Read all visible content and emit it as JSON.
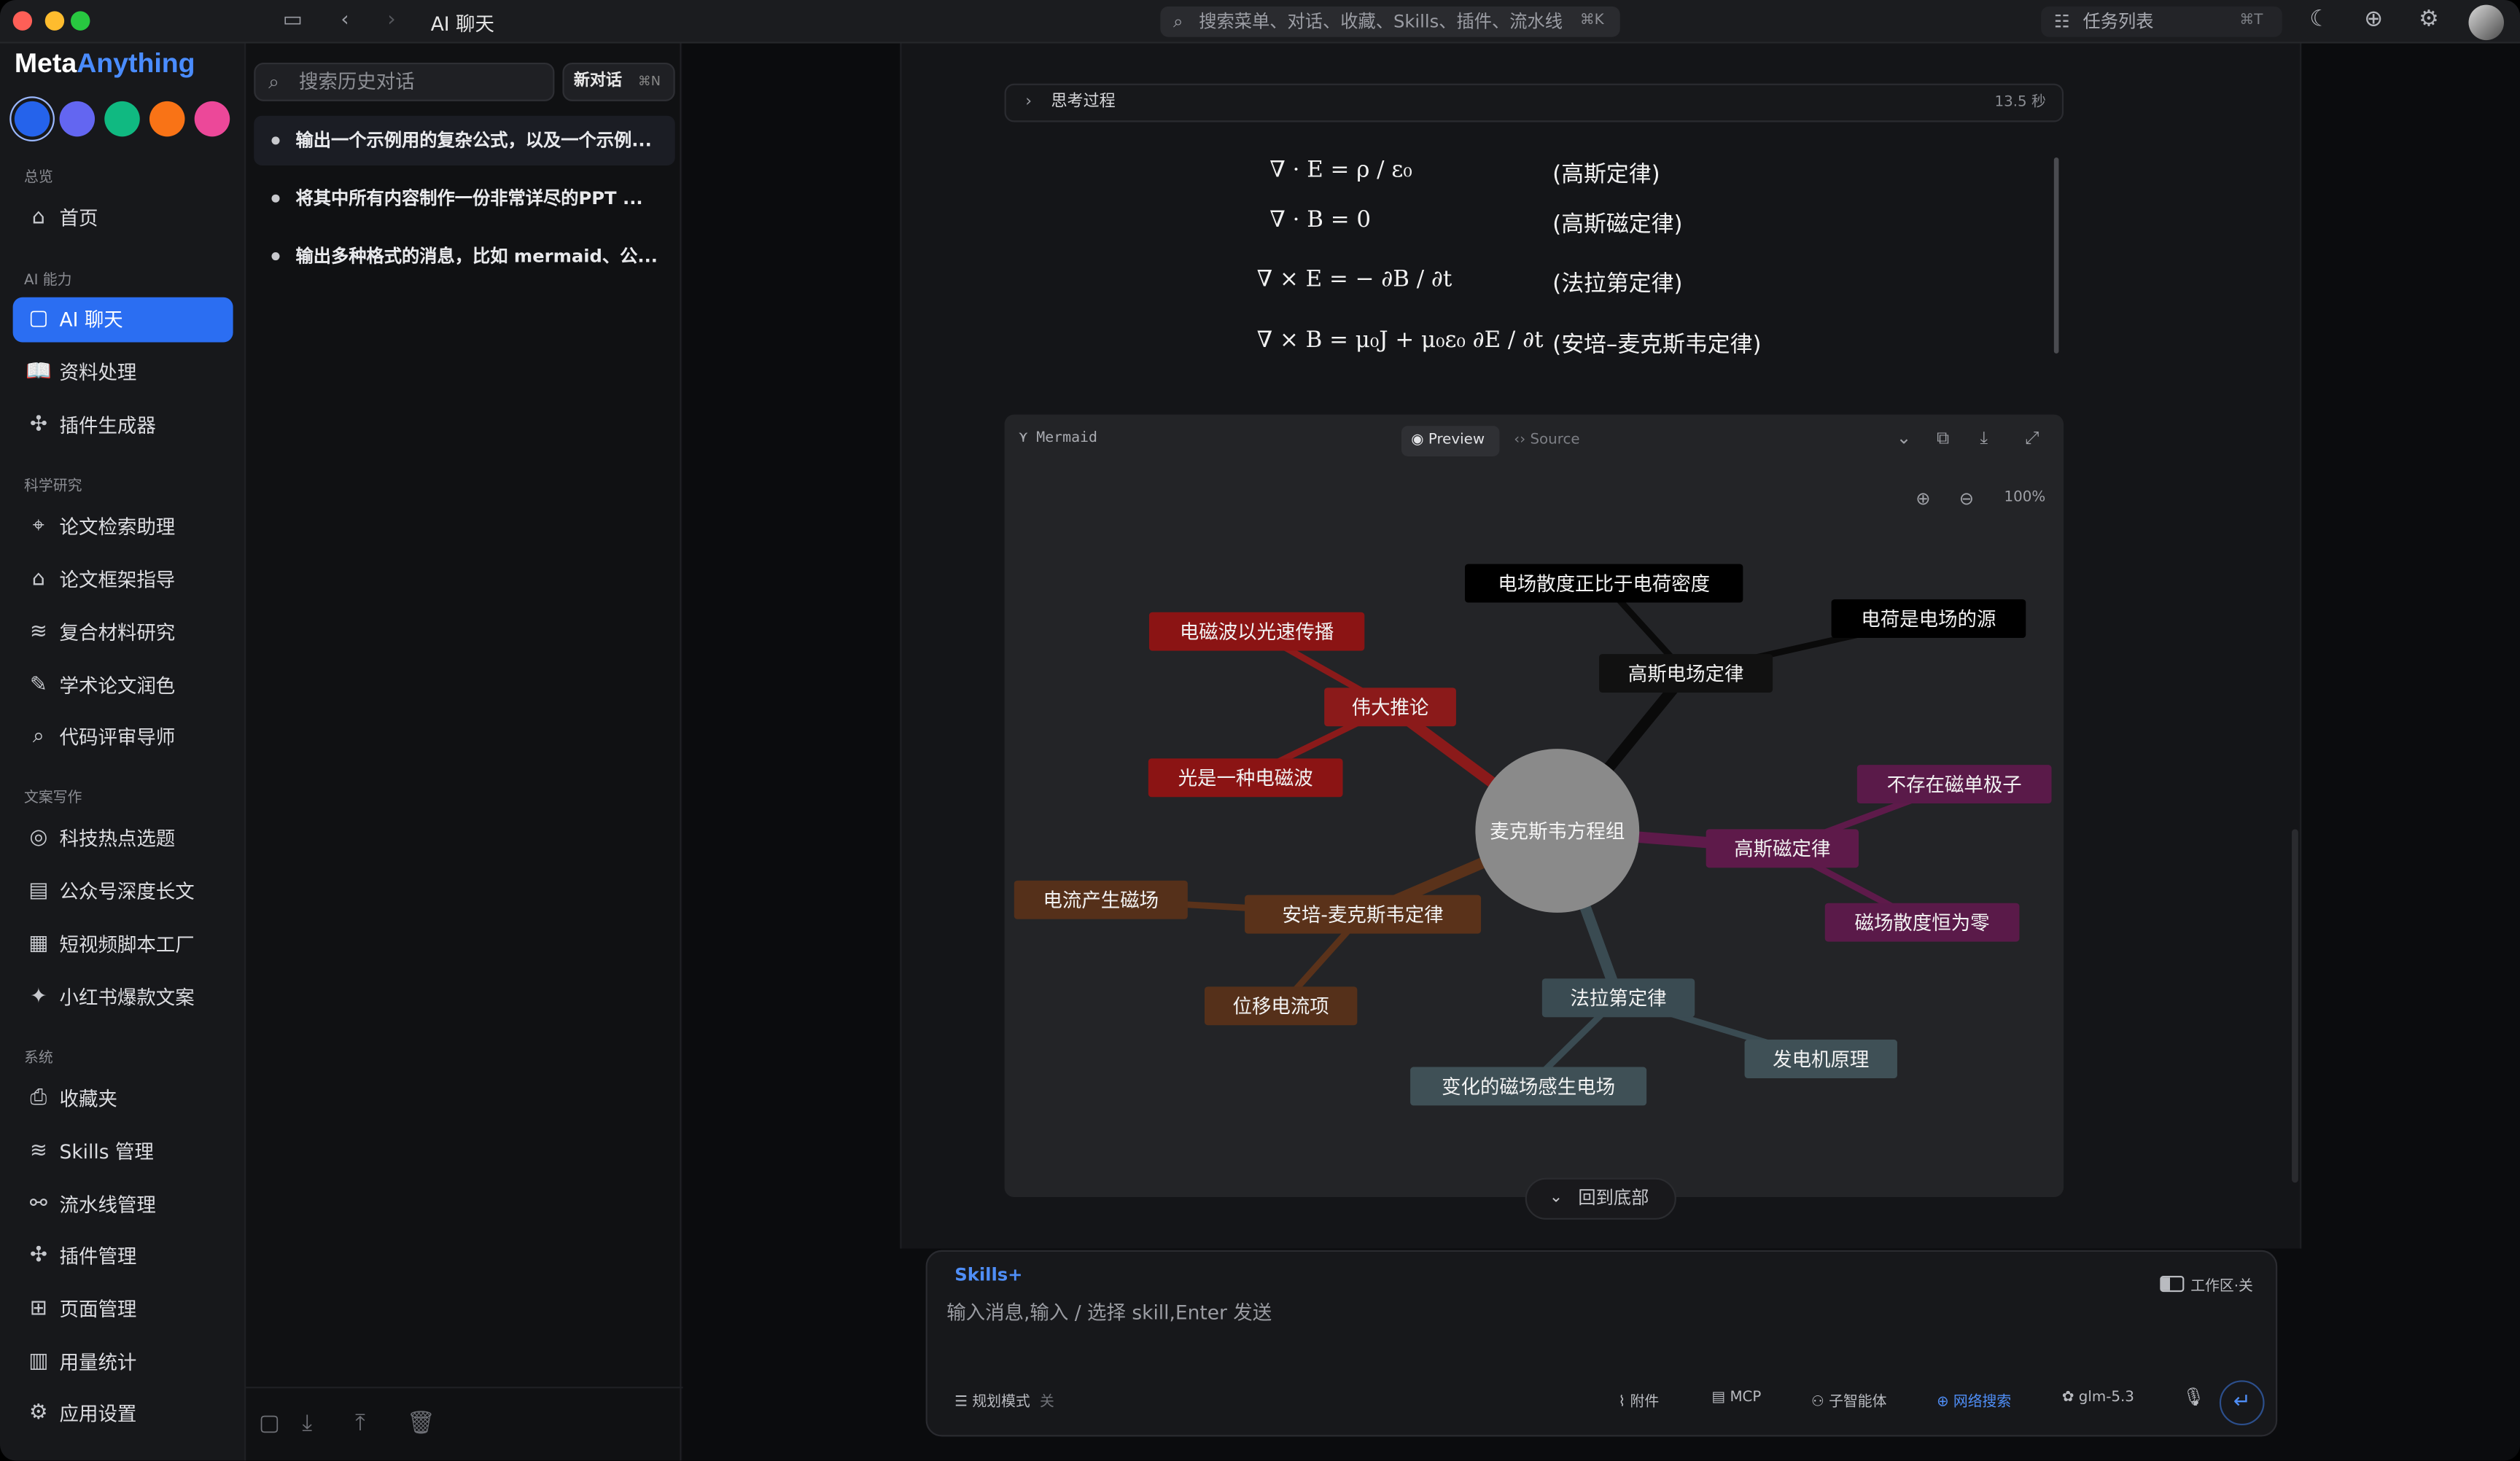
{
  "window": {
    "title": "AI 聊天",
    "search_placeholder": "搜索菜单、对话、收藏、Skills、插件、流水线",
    "search_shortcut": "⌘K",
    "tasks_label": "任务列表",
    "tasks_shortcut": "⌘T"
  },
  "brand": {
    "part1": "Meta",
    "part2": "Anything"
  },
  "theme_colors": [
    "#2563eb",
    "#6366f1",
    "#10b981",
    "#f97316",
    "#ec4899"
  ],
  "sidebar": {
    "sections": [
      {
        "title": "总览",
        "items": [
          {
            "label": "首页",
            "icon": "home-icon"
          }
        ]
      },
      {
        "title": "AI 能力",
        "items": [
          {
            "label": "AI 聊天",
            "icon": "chat-icon",
            "active": true
          },
          {
            "label": "资料处理",
            "icon": "book-icon"
          },
          {
            "label": "插件生成器",
            "icon": "puzzle-icon"
          }
        ]
      },
      {
        "title": "科学研究",
        "items": [
          {
            "label": "论文检索助理",
            "icon": "telescope-icon"
          },
          {
            "label": "论文框架指导",
            "icon": "graduation-cap-icon"
          },
          {
            "label": "复合材料研究",
            "icon": "layers-icon"
          },
          {
            "label": "学术论文润色",
            "icon": "pen-icon"
          },
          {
            "label": "代码评审导师",
            "icon": "search-code-icon"
          }
        ]
      },
      {
        "title": "文案写作",
        "items": [
          {
            "label": "科技热点选题",
            "icon": "target-icon"
          },
          {
            "label": "公众号深度长文",
            "icon": "document-icon"
          },
          {
            "label": "短视频脚本工厂",
            "icon": "clapper-icon"
          },
          {
            "label": "小红书爆款文案",
            "icon": "sparkle-icon"
          }
        ]
      },
      {
        "title": "系统",
        "items": [
          {
            "label": "收藏夹",
            "icon": "bookmark-icon"
          },
          {
            "label": "Skills 管理",
            "icon": "layers-icon"
          },
          {
            "label": "流水线管理",
            "icon": "workflow-icon"
          },
          {
            "label": "插件管理",
            "icon": "puzzle-icon"
          },
          {
            "label": "页面管理",
            "icon": "grid-icon"
          },
          {
            "label": "用量统计",
            "icon": "bar-chart-icon"
          },
          {
            "label": "应用设置",
            "icon": "gear-icon"
          }
        ]
      }
    ]
  },
  "history": {
    "search_placeholder": "搜索历史对话",
    "new_chat_label": "新对话",
    "new_chat_shortcut": "⌘N",
    "items": [
      "输出一个示例用的复杂公式，以及一个示例...",
      "将其中所有内容制作一份非常详尽的PPT ...",
      "输出多种格式的消息，比如 mermaid、公..."
    ]
  },
  "thinking": {
    "label": "思考过程",
    "duration": "13.5 秒"
  },
  "equations": [
    {
      "formula": "∇ · E = ρ / ε₀",
      "name": "(高斯定律)"
    },
    {
      "formula": "∇ · B = 0",
      "name": "(高斯磁定律)"
    },
    {
      "formula": "∇ × E = − ∂B / ∂t",
      "name": "(法拉第定律)"
    },
    {
      "formula": "∇ × B = μ₀J + μ₀ε₀ ∂E / ∂t",
      "name": "(安培–麦克斯韦定律)"
    }
  ],
  "mermaid": {
    "lang_label": "Mermaid",
    "preview_label": "Preview",
    "source_label": "Source",
    "zoom": "100%",
    "root": "麦克斯韦方程组",
    "branches": [
      {
        "label": "伟大推论",
        "color": "#8b1a1a",
        "children": [
          "电磁波以光速传播",
          "光是一种电磁波"
        ]
      },
      {
        "label": "高斯电场定律",
        "color": "#111111",
        "children": [
          "电场散度正比于电荷密度",
          "电荷是电场的源"
        ]
      },
      {
        "label": "高斯磁定律",
        "color": "#5e1a4a",
        "children": [
          "不存在磁单极子",
          "磁场散度恒为零"
        ]
      },
      {
        "label": "安培-麦克斯韦定律",
        "color": "#5a321a",
        "children": [
          "电流产生磁场",
          "位移电流项"
        ]
      },
      {
        "label": "法拉第定律",
        "color": "#3a4b52",
        "children": [
          "变化的磁场感生电场",
          "发电机原理"
        ]
      }
    ]
  },
  "back_to_bottom": "回到底部",
  "composer": {
    "skills_label": "Skills+",
    "workspace_label": "工作区·关",
    "placeholder": "输入消息,输入 / 选择 skill,Enter 发送",
    "plan_mode": "规划模式",
    "plan_state": "关",
    "attach": "附件",
    "mcp": "MCP",
    "subagent": "子智能体",
    "web_search": "网络搜索",
    "model": "glm-5.3"
  }
}
